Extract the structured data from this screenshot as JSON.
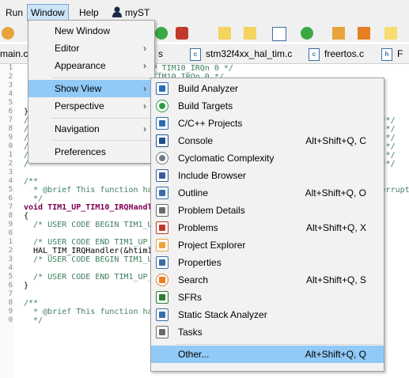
{
  "menubar": {
    "items": [
      "Run",
      "Window",
      "Help"
    ],
    "user": "myST"
  },
  "tabs": [
    "main.c",
    "s",
    "stm32f4xx_hal_tim.c",
    "freertos.c",
    "F"
  ],
  "code": [
    {
      "n": "1",
      "t": "  /* USER CODE BEGIN TIM1_UP_TIM10_IRQn 0 */"
    },
    {
      "n": "2",
      "t": "  /* USER CODE END TIM1_UP_TIM10_IRQn 0 */"
    },
    {
      "n": "3",
      "t": ""
    },
    {
      "n": "4",
      "t": "  /* USER CODE BEGIN TIM1_UP_TIM10_IRQn 1 */"
    },
    {
      "n": "5",
      "t": ""
    },
    {
      "n": "6",
      "t": "}"
    },
    {
      "n": "7",
      "t": "/****************************************************************************/"
    },
    {
      "n": "8",
      "t": "/*                                                                          */"
    },
    {
      "n": "9",
      "t": "/*                                                                          */"
    },
    {
      "n": "0",
      "t": "/* For the available peripheral interrupt handler names,                    */"
    },
    {
      "n": "1",
      "t": "/* please refer to the startup file (startup_stm32f4xx.s).                  */"
    },
    {
      "n": "2",
      "t": "/****************************************************************************/"
    },
    {
      "n": "3",
      "t": ""
    },
    {
      "n": "4",
      "t": "/**"
    },
    {
      "n": "5",
      "t": "  * @brief This function handles TIM1 update interrupt and TIM10 global interrupt."
    },
    {
      "n": "6",
      "t": "  */"
    },
    {
      "n": "7",
      "t": "void TIM1_UP_TIM10_IRQHandler(void)"
    },
    {
      "n": "8",
      "t": "{"
    },
    {
      "n": "9",
      "t": "  /* USER CODE BEGIN TIM1_UP_TIM10_IRQn 0 */"
    },
    {
      "n": "0",
      "t": ""
    },
    {
      "n": "1",
      "t": "  /* USER CODE END TIM1_UP_TIM10_IRQn 0 */"
    },
    {
      "n": "2",
      "t": "  HAL_TIM_IRQHandler(&htim10);"
    },
    {
      "n": "3",
      "t": "  /* USER CODE BEGIN TIM1_UP_TIM10_IRQn 1 */"
    },
    {
      "n": "4",
      "t": ""
    },
    {
      "n": "5",
      "t": "  /* USER CODE END TIM1_UP_TIM10_IRQn 1 */"
    },
    {
      "n": "6",
      "t": "}"
    },
    {
      "n": "7",
      "t": ""
    },
    {
      "n": "8",
      "t": "/**"
    },
    {
      "n": "9",
      "t": "  * @brief This function handles TIM11 global interrupt / TIM11 g"
    },
    {
      "n": "0",
      "t": "  */"
    }
  ],
  "window_menu": {
    "items": [
      {
        "label": "New Window",
        "arrow": ""
      },
      {
        "label": "Editor",
        "arrow": "›"
      },
      {
        "label": "Appearance",
        "arrow": "›"
      },
      {
        "label": "Show View",
        "arrow": "›"
      },
      {
        "label": "Perspective",
        "arrow": "›"
      },
      {
        "label": "Navigation",
        "arrow": "›"
      },
      {
        "label": "Preferences",
        "arrow": ""
      }
    ],
    "selected": "Show View"
  },
  "show_view": {
    "items": [
      {
        "label": "Build Analyzer",
        "shortcut": "",
        "icon": "build-analyzer-icon"
      },
      {
        "label": "Build Targets",
        "shortcut": "",
        "icon": "build-targets-icon"
      },
      {
        "label": "C/C++ Projects",
        "shortcut": "",
        "icon": "cpp-projects-icon"
      },
      {
        "label": "Console",
        "shortcut": "Alt+Shift+Q, C",
        "icon": "console-icon"
      },
      {
        "label": "Cyclomatic Complexity",
        "shortcut": "",
        "icon": "cyclomatic-complexity-icon"
      },
      {
        "label": "Include Browser",
        "shortcut": "",
        "icon": "include-browser-icon"
      },
      {
        "label": "Outline",
        "shortcut": "Alt+Shift+Q, O",
        "icon": "outline-icon"
      },
      {
        "label": "Problem Details",
        "shortcut": "",
        "icon": "problem-details-icon"
      },
      {
        "label": "Problems",
        "shortcut": "Alt+Shift+Q, X",
        "icon": "problems-icon"
      },
      {
        "label": "Project Explorer",
        "shortcut": "",
        "icon": "project-explorer-icon"
      },
      {
        "label": "Properties",
        "shortcut": "",
        "icon": "properties-icon"
      },
      {
        "label": "Search",
        "shortcut": "Alt+Shift+Q, S",
        "icon": "search-icon"
      },
      {
        "label": "SFRs",
        "shortcut": "",
        "icon": "sfrs-icon"
      },
      {
        "label": "Static Stack Analyzer",
        "shortcut": "",
        "icon": "static-stack-analyzer-icon"
      },
      {
        "label": "Tasks",
        "shortcut": "",
        "icon": "tasks-icon"
      },
      {
        "label": "Other...",
        "shortcut": "Alt+Shift+Q, Q",
        "icon": ""
      }
    ],
    "selected": "Other..."
  },
  "colors": {
    "menu_bg": "#f2f2f2",
    "selection": "#91c9f7",
    "comment": "#3f7f5f",
    "keyword": "#7f0055"
  }
}
